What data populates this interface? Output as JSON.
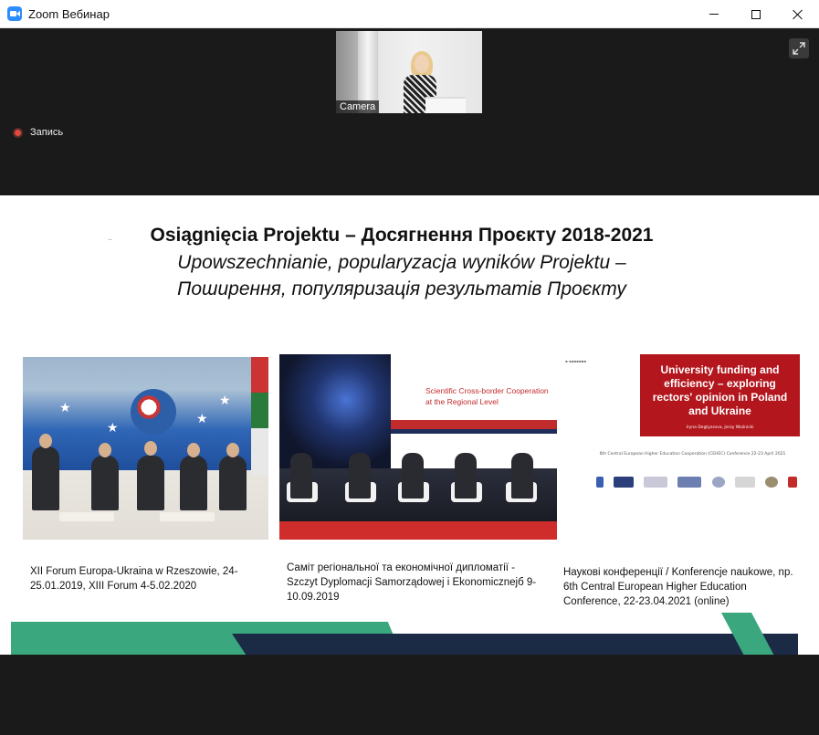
{
  "window": {
    "title": "Zoom Вебинар",
    "icon": "zoom-app-icon"
  },
  "camera": {
    "label": "Camera"
  },
  "recording": {
    "label": "Запись",
    "color": "#e0483e"
  },
  "slide": {
    "bullet": "..",
    "title": "Osiągnięcia Projektu – Досягнення Проєкту 2018-2021",
    "subtitle_line1": "Upowszechnianie, popularyzacja wyników Projektu –",
    "subtitle_line2": "Поширення, популяризація результатів Проєкту",
    "photo2_screen_title": "Scientific Cross-border Cooperation at the Regional Level",
    "photo3_red_title": "University funding and efficiency – exploring rectors' opinion in Poland and Ukraine",
    "photo3_authors": "Iryna Degtyarova, Jerzy Woźnicki",
    "photo3_conference": "6th Central European Higher Education Cooperation (CEHEC) Conference 22-23 April 2021",
    "captions": [
      "XII Forum Europa-Ukraina w Rzeszowie, 24-25.01.2019, XIII Forum 4-5.02.2020",
      "Саміт регіональної та економічної дипломатії - Szczyt Dyplomacji Samorządowej i Ekonomicznejб 9-10.09.2019",
      "Наукові конференції / Konferencje naukowe, np. 6th Central European Higher Education Conference, 22-23.04.2021 (online)"
    ],
    "colors": {
      "green": "#3aa77e",
      "navy": "#1b2a45",
      "red": "#b3161c"
    }
  }
}
